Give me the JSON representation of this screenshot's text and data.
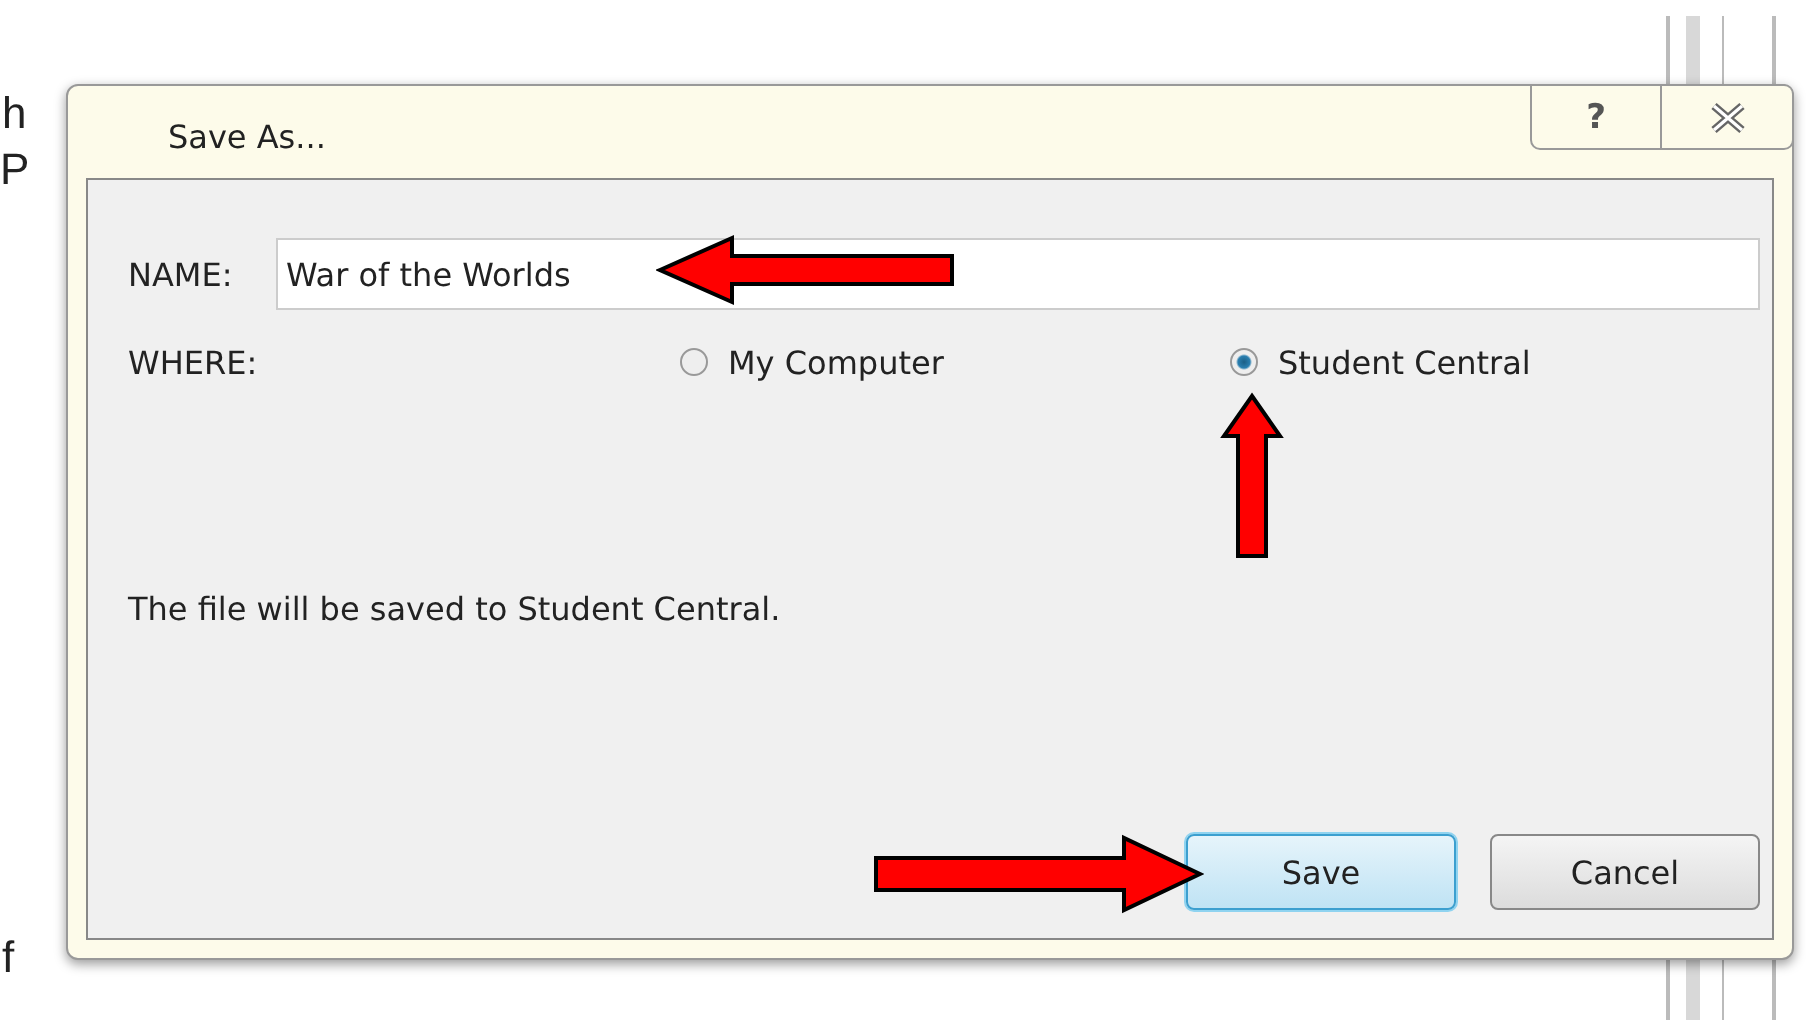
{
  "background_text": [
    "h",
    "P",
    "f"
  ],
  "dialog": {
    "title": "Save As...",
    "help_button": "?",
    "name_label": "NAME:",
    "name_value": "War of the Worlds",
    "where_label": "WHERE:",
    "locations": [
      {
        "label": "My Computer",
        "selected": false
      },
      {
        "label": "Student Central",
        "selected": true
      }
    ],
    "message": "The file will be saved to Student Central.",
    "buttons": [
      {
        "label": "Save",
        "default": true
      },
      {
        "label": "Cancel",
        "default": false
      }
    ]
  }
}
